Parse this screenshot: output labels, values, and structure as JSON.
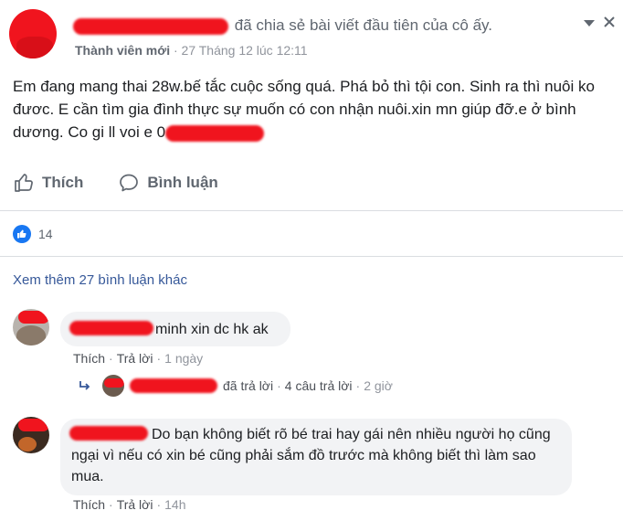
{
  "post": {
    "header_action": "đã chia sẻ bài viết đầu tiên của cô ấy.",
    "member_badge": "Thành viên mới",
    "timestamp": "27 Tháng 12 lúc 12:11",
    "text": "Em đang mang thai 28w.bế tắc cuộc sống quá. Phá bỏ thì tội con. Sinh ra thì nuôi ko đươc. E cần tìm gia đình thực sự muốn có con nhận nuôi.xin mn giúp đỡ.e ở bình dương. Co gi ll voi e 0"
  },
  "actions": {
    "like_label": "Thích",
    "comment_label": "Bình luận"
  },
  "reactions": {
    "count": "14"
  },
  "more_comments": "Xem thêm 27 bình luận khác",
  "comments": [
    {
      "text": "minh xin dc hk ak",
      "like": "Thích",
      "reply": "Trả lời",
      "time": "1 ngày",
      "replies": {
        "replied_text": "đã trả lời",
        "count_text": "4 câu trả lời",
        "time": "2 giờ"
      }
    },
    {
      "text": "Do bạn không biết rõ bé trai hay gái nên nhiều người họ cũng ngại vì nếu có xin bé cũng phải sắm đồ trước mà không biết thì làm sao mua.",
      "like": "Thích",
      "reply": "Trả lời",
      "time": "14h"
    }
  ],
  "colors": {
    "link": "#365899",
    "like_blue": "#1877f2",
    "redaction": "#f0141e"
  }
}
